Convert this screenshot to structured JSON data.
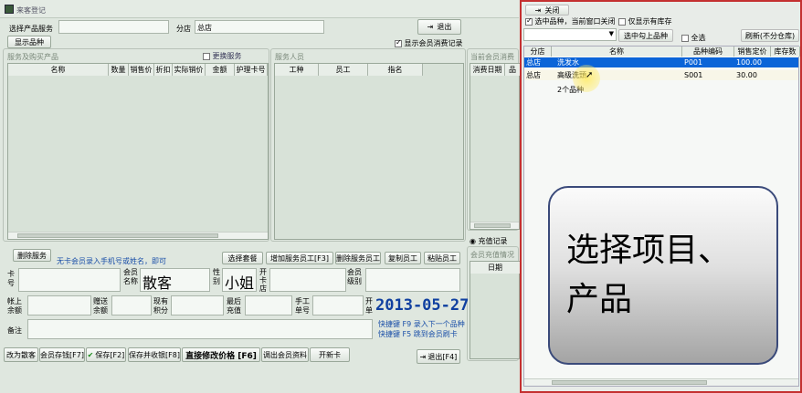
{
  "window": {
    "title": "来客登记"
  },
  "top": {
    "select_label": "选择产品服务",
    "branch_label": "分店",
    "branch_value": "总店",
    "exit_label": "退出",
    "show_items_label": "显示品种",
    "show_member_records_label": "显示会员消费记录"
  },
  "services": {
    "title": "服务及购买产品",
    "change_service_label": "更换服务",
    "columns": [
      "名称",
      "数量",
      "销售价",
      "折扣",
      "实际销价",
      "金额",
      "护理卡号"
    ]
  },
  "staff": {
    "title": "服务人员",
    "columns": [
      "工种",
      "员工",
      "指名"
    ]
  },
  "member_history": {
    "title": "当前会员消费记",
    "columns": [
      "消费日期",
      "品"
    ]
  },
  "recharge": {
    "records_label": "充值记录",
    "title": "会员充值情况",
    "columns": [
      "日期"
    ]
  },
  "actions": {
    "delete_service": "删除服务",
    "hint": "无卡会员录入手机号或姓名，即可",
    "select_package": "选择套餐",
    "add_staff": "增加服务员工[F3]",
    "delete_staff": "删除服务员工",
    "copy_staff": "复制员工",
    "paste_staff": "粘贴员工"
  },
  "member": {
    "card_label": "卡号",
    "name_label": "会员名称",
    "name_value": "散客",
    "gender_label": "性别",
    "gender_value": "小姐",
    "open_store_label": "开卡店",
    "level_label": "会员级别",
    "balance_label": "帐上余额",
    "gift_balance_label": "赠送余额",
    "points_label": "现有积分",
    "last_recharge_label": "最后充值",
    "manual_order_label": "手工单号",
    "open_date_label": "开单",
    "date_value": "2013-05-27",
    "remark_label": "备注",
    "shortcut1": "快捷键 F9 录入下一个品种",
    "shortcut2": "快捷键 F5 跳到会员刷卡"
  },
  "bottom": {
    "walk_in": "改为散客",
    "member_deposit": "会员存钱[F7]",
    "save": "保存[F2]",
    "save_receipt": "保存并收银[F8]",
    "edit_price": "直接修改价格 [F6]",
    "call_member": "调出会员资料",
    "open_card": "开新卡",
    "exit": "退出[F4]"
  },
  "picker": {
    "close_label": "关闭",
    "close_on_select_label": "选中品种，当前窗口关闭",
    "in_stock_only_label": "仅显示有库存",
    "select_checked_label": "选中勾上品种",
    "select_all_label": "全选",
    "refresh_label": "刷新(不分仓库)",
    "columns": [
      "分店",
      "名称",
      "品种编码",
      "销售定价",
      "库存数"
    ],
    "rows": [
      {
        "store": "总店",
        "name": "洗发水",
        "code": "P001",
        "price": "100.00",
        "stock": ""
      },
      {
        "store": "总店",
        "name": "高级洗頭",
        "code": "S001",
        "price": "30.00",
        "stock": ""
      }
    ],
    "count_label": "2个品种",
    "overlay_text": "选择项目、产品"
  },
  "colors": {
    "selected_row": "#0a64d8",
    "date_blue": "#1040a0",
    "picker_border": "#c43030"
  }
}
